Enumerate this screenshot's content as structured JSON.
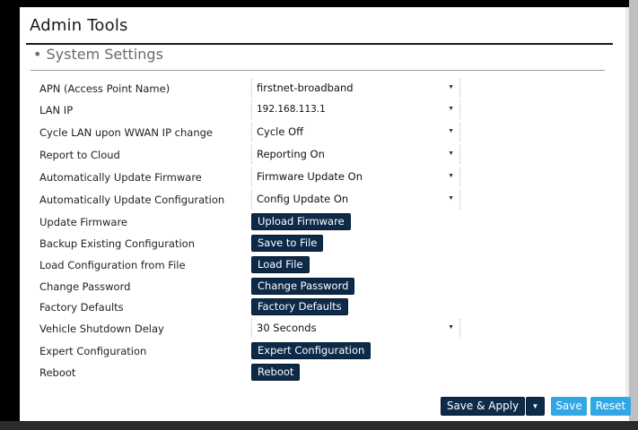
{
  "page": {
    "title": "Admin Tools",
    "section_title": "• System Settings"
  },
  "settings": {
    "apn": {
      "label": "APN (Access Point Name)",
      "value": "firstnet-broadband"
    },
    "lan_ip": {
      "label": "LAN IP",
      "value": "192.168.113.1"
    },
    "cycle_lan": {
      "label": "Cycle LAN upon WWAN IP change",
      "value": "Cycle Off"
    },
    "report_cloud": {
      "label": "Report to Cloud",
      "value": "Reporting On"
    },
    "auto_fw": {
      "label": "Automatically Update Firmware",
      "value": "Firmware Update On"
    },
    "auto_config": {
      "label": "Automatically Update Configuration",
      "value": "Config Update On"
    },
    "update_fw": {
      "label": "Update Firmware",
      "button": "Upload Firmware"
    },
    "backup_config": {
      "label": "Backup Existing Configuration",
      "button": "Save to File"
    },
    "load_config": {
      "label": "Load Configuration from File",
      "button": "Load File"
    },
    "change_password": {
      "label": "Change Password",
      "button": "Change Password"
    },
    "factory_defaults": {
      "label": "Factory Defaults",
      "button": "Factory Defaults"
    },
    "shutdown_delay": {
      "label": "Vehicle Shutdown Delay",
      "value": "30 Seconds"
    },
    "expert_config": {
      "label": "Expert Configuration",
      "button": "Expert Configuration"
    },
    "reboot": {
      "label": "Reboot",
      "button": "Reboot"
    }
  },
  "footer": {
    "save_apply": "Save & Apply",
    "save": "Save",
    "reset": "Reset"
  },
  "icons": {
    "dropdown": "chevron-down-icon",
    "split_menu": "caret-down-icon"
  },
  "colors": {
    "primary_button": "#0d2a49",
    "secondary_button": "#33a7e3"
  }
}
